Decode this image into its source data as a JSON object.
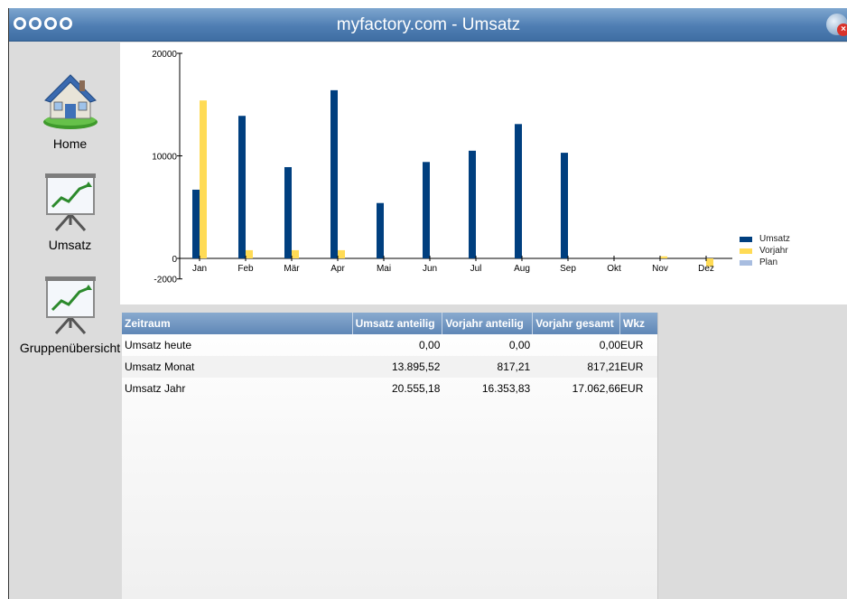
{
  "window": {
    "title": "myfactory.com - Umsatz"
  },
  "sidebar": {
    "items": [
      {
        "label": "Home"
      },
      {
        "label": "Umsatz"
      },
      {
        "label": "Gruppenübersicht"
      }
    ]
  },
  "colors": {
    "umsatz": "#003f7f",
    "vorjahr": "#ffdb55",
    "plan": "#a8bde0",
    "header": "#6b8fbd"
  },
  "chart_data": {
    "type": "bar",
    "categories": [
      "Jan",
      "Feb",
      "Mär",
      "Apr",
      "Mai",
      "Jun",
      "Jul",
      "Aug",
      "Sep",
      "Okt",
      "Nov",
      "Dez"
    ],
    "series": [
      {
        "name": "Umsatz",
        "values": [
          6700,
          13900,
          8900,
          16400,
          5400,
          9400,
          10500,
          13100,
          10300,
          0,
          0,
          0
        ]
      },
      {
        "name": "Vorjahr",
        "values": [
          15400,
          800,
          800,
          800,
          0,
          0,
          0,
          0,
          0,
          0,
          200,
          -800
        ]
      },
      {
        "name": "Plan",
        "values": [
          0,
          0,
          0,
          0,
          0,
          0,
          0,
          0,
          0,
          0,
          0,
          0
        ]
      }
    ],
    "yticks": [
      "20000",
      "10000",
      "0",
      "-2000"
    ],
    "ylim": [
      -2000,
      20000
    ],
    "legend_position": "right"
  },
  "table": {
    "headers": [
      "Zeitraum",
      "Umsatz anteilig",
      "Vorjahr anteilig",
      "Vorjahr gesamt",
      "Wkz"
    ],
    "rows": [
      [
        "Umsatz heute",
        "0,00",
        "0,00",
        "0,00",
        "EUR"
      ],
      [
        "Umsatz Monat",
        "13.895,52",
        "817,21",
        "817,21",
        "EUR"
      ],
      [
        "Umsatz Jahr",
        "20.555,18",
        "16.353,83",
        "17.062,66",
        "EUR"
      ]
    ]
  }
}
